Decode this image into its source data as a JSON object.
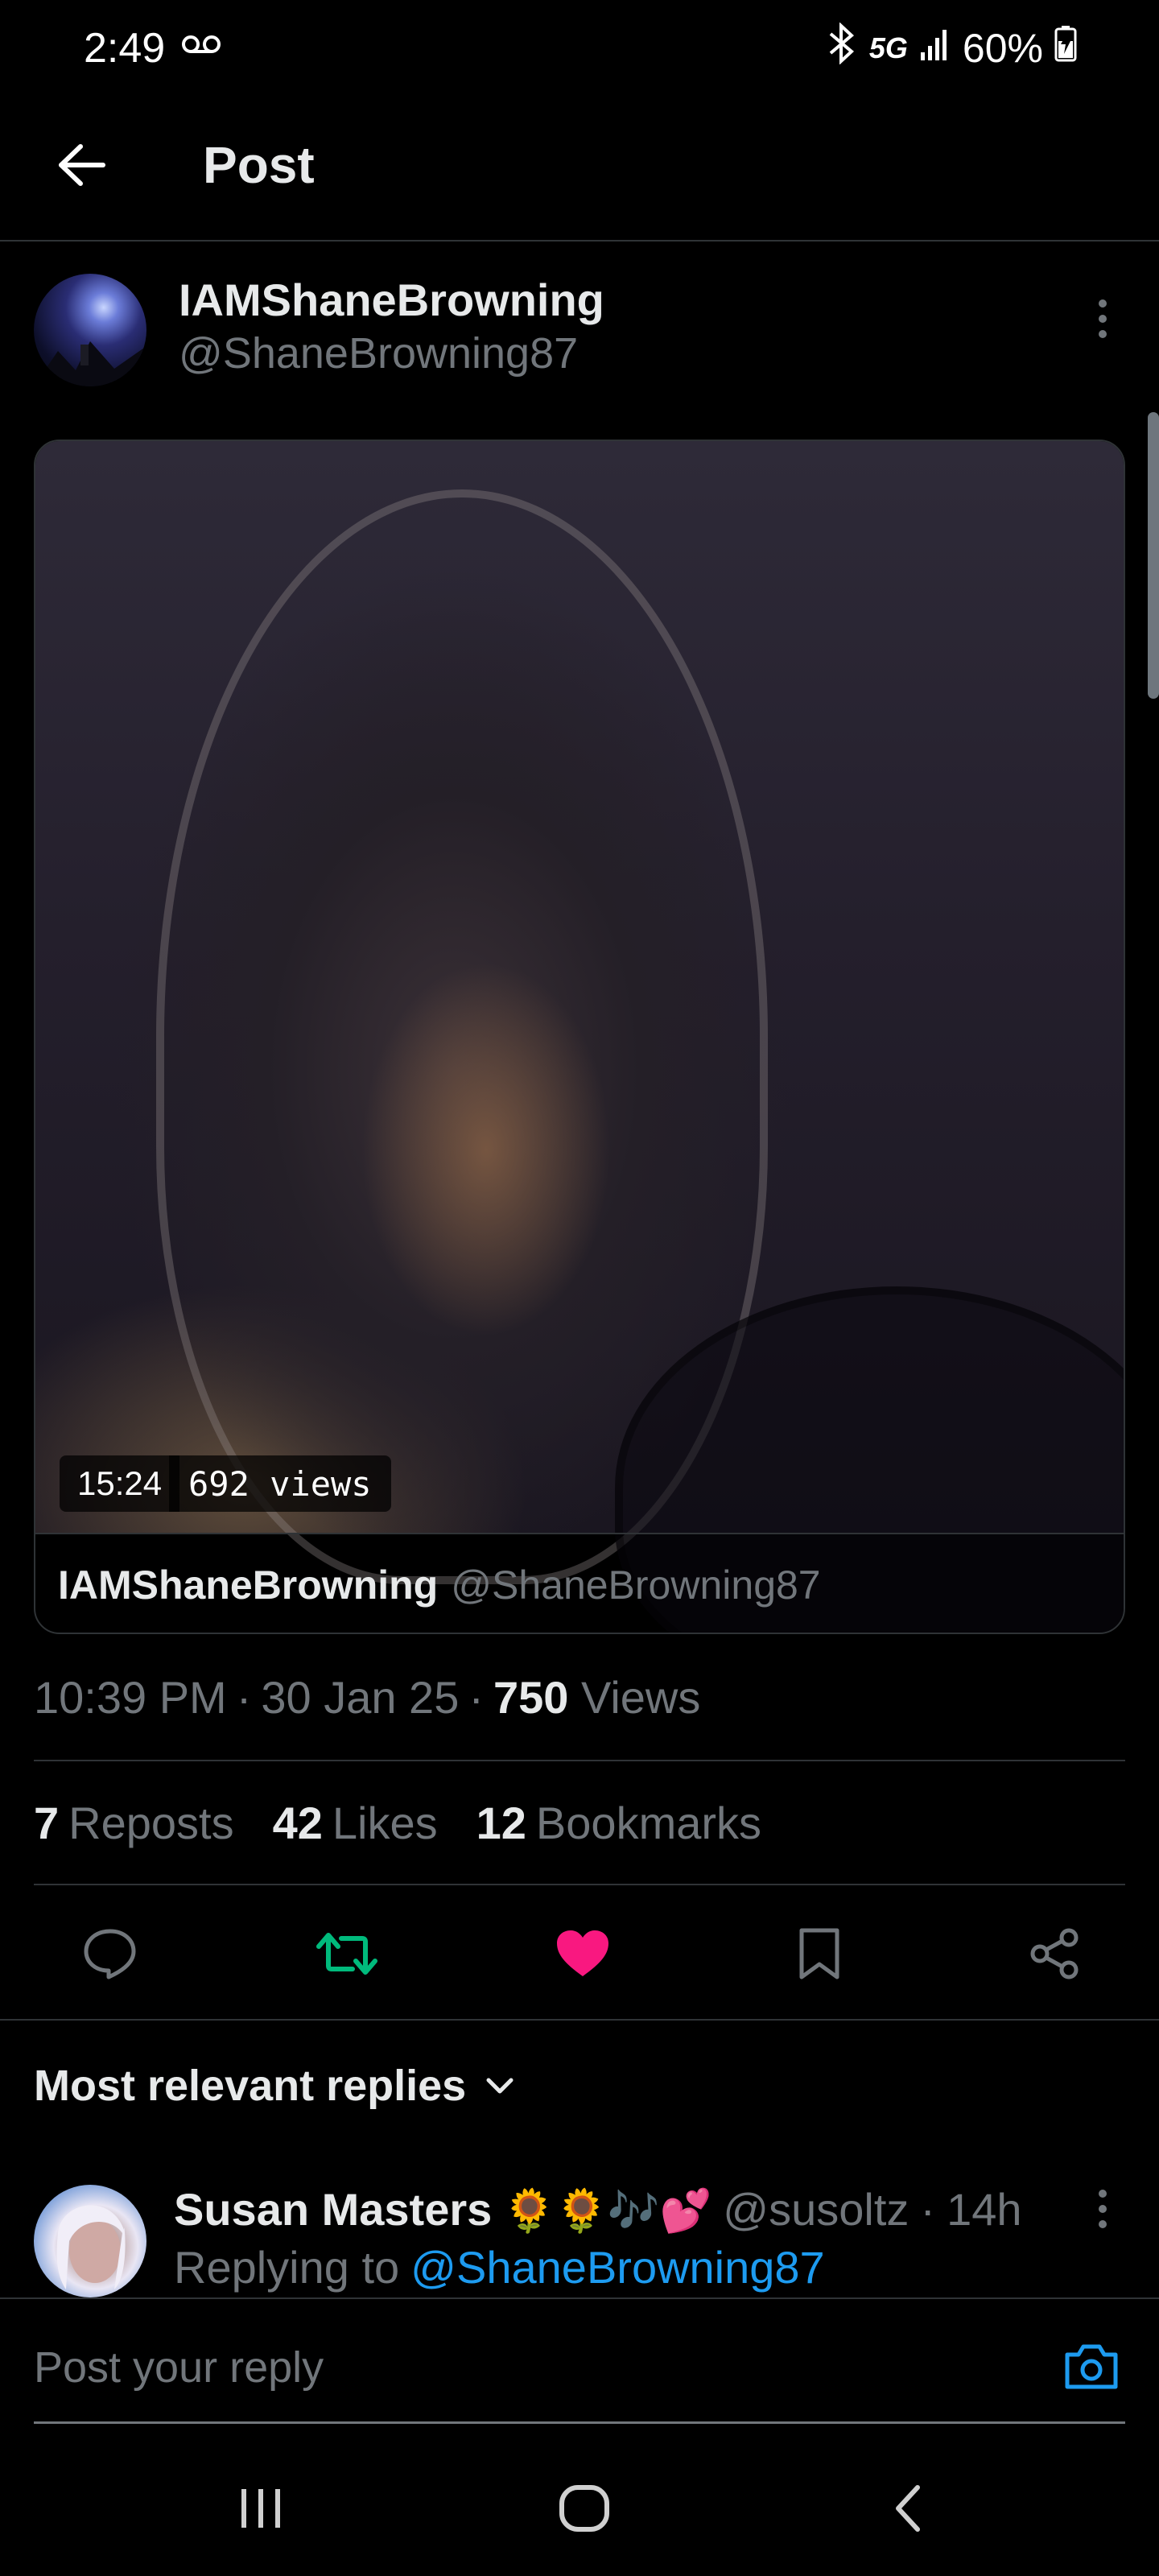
{
  "status_bar": {
    "time": "2:49",
    "network": "5G",
    "battery": "60%"
  },
  "header": {
    "title": "Post"
  },
  "post": {
    "author_name": "IAMShaneBrowning",
    "author_handle": "@ShaneBrowning87",
    "video": {
      "duration": "15:24",
      "views": "692 views"
    },
    "card_name": "IAMShaneBrowning",
    "card_handle": "@ShaneBrowning87",
    "time": "10:39 PM",
    "date": "30 Jan 25",
    "views_count": "750",
    "views_label": "Views",
    "separator": "·",
    "reposts_count": "7",
    "reposts_label": "Reposts",
    "likes_count": "42",
    "likes_label": "Likes",
    "bookmarks_count": "12",
    "bookmarks_label": "Bookmarks",
    "liked": true,
    "reposted": true
  },
  "replies": {
    "sort_label": "Most relevant replies",
    "items": [
      {
        "name": "Susan Masters",
        "emoji": "🌻🌻🎶💕",
        "handle": "@susoltz",
        "time": "14h",
        "replying_label": "Replying to",
        "replying_to": "@ShaneBrowning87"
      }
    ]
  },
  "composer": {
    "placeholder": "Post your reply"
  },
  "colors": {
    "accent": "#1d9bf0",
    "like": "#f91880",
    "repost": "#00ba7c",
    "muted": "#71767b",
    "text": "#e7e9ea",
    "border": "#2f3336"
  },
  "icons": {
    "back": "arrow-left-icon",
    "more": "more-vertical-icon",
    "reply": "comment-icon",
    "repost": "repost-icon",
    "like": "heart-icon",
    "bookmark": "bookmark-icon",
    "share": "share-icon",
    "camera": "camera-icon"
  }
}
